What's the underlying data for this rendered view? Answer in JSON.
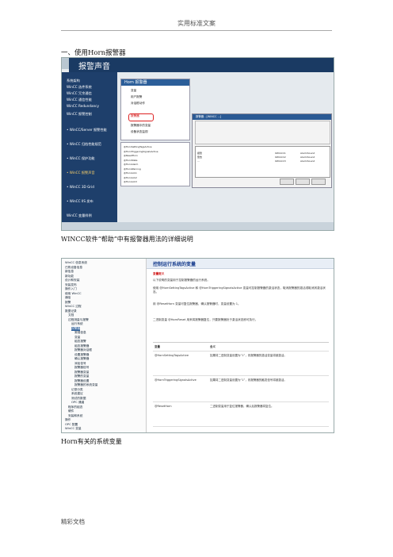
{
  "header": {
    "title": "实用标准文案"
  },
  "section_heading": "一、使用Horn报警器",
  "screenshot1": {
    "title": "报警声音",
    "left_menu": [
      "系统架构",
      "WinCC 选件系统",
      "WinCC 冗余通信",
      "WinCC 通信性能",
      "WinCC Redundancy",
      "WinCC 报警控制",
      "• WinCC/Server 报警性能",
      "• WinCC 归档性能规范",
      "• WinCC 保护功能",
      "• WinCC 报警声音",
      "• WinCC 3D Grid",
      "• WinCC IIS 发布",
      "WinCC 变量样例"
    ],
    "panelA_title": "Horn 报警器",
    "panelA_items": [
      "变量",
      "用户报警",
      "对话框动作",
      "报警器",
      "报警器中的变量",
      "设备状态监视"
    ],
    "panelB_title": "报警器 - [WINCC ...]",
    "panelB_rows": [
      [
        "报警",
        "0WinCC1",
        "AlarmSound"
      ],
      [
        "警告",
        "0WinCC2",
        "AlarmSound"
      ],
      [
        "...",
        "0WinCC3",
        "AlarmSound"
      ]
    ],
    "panelC_rows": [
      "@HornSettingTagsActive",
      "@HornTriggeringSignalsActive",
      "@ResetHorn",
      "@HornState",
      "@HornAlarm",
      "@HornWarning",
      "@HornAck1",
      "@HornAck2",
      "@HornAck3"
    ]
  },
  "caption1": "WINCC软件“帮助”中有报警器用法的详细说明",
  "screenshot2": {
    "tree_items": [
      "WinCC 信息系统",
      "已购设备信息",
      "新信息",
      "新功能",
      "设计和安装",
      "安装发布",
      "操作入门",
      "使用 WinCC",
      "通信",
      "报警",
      "WinCC 过程",
      "数据记录",
      "文档",
      "过程测量与报警",
      "运行系统",
      "报警器",
      "常规信息",
      "变量",
      "组态报警",
      "组态报警器",
      "报警器对话框",
      "设置报警器",
      "确认报警器",
      "添加信号",
      "报警器信号",
      "报警器变量",
      "报警的变量",
      "报警器设置",
      "报警器的系统变量",
      "记录分类",
      "系统建议",
      "测试的数据",
      "OPC 通道",
      "程序的组态",
      "硬件",
      "安装和系统",
      "操作",
      "OPC 配置",
      "WinCC 变量"
    ],
    "doc_title": "控制运行系统的变量",
    "doc_subtitle": "变量定义",
    "paragraphs": [
      "以下说明的变量用于控制报警器的运行系统。",
      "使用 @HornSettingTagsActive 和 @HornTriggeringSignalsActive 变量可控制报警器的激活状态，取消报警器的激活或取消其激活状态。",
      "用 @ResetHorn 变量可复位报警器，确认报警器时，变量设置为 1。",
      "二进制变量 @HornReset 用来将报警器复位，只要报警器处于激活状态即可执行。"
    ],
    "table_headers": [
      "变量",
      "含义"
    ],
    "table_rows": [
      [
        "@HornSettingTagsActive",
        "如果将二进制变量设置为“1”，则报警器的激活变量将被激活。"
      ],
      [
        "@HornTriggeringSignalsActive",
        "如果将二进制变量设置为“1”，则报警器的触发信号将被激活。"
      ],
      [
        "@ResetHorn",
        "二进制变量用于复位报警器，确认后报警器将复位。"
      ]
    ]
  },
  "caption2": "Horn有关的系统变量",
  "footer": "精彩文档"
}
